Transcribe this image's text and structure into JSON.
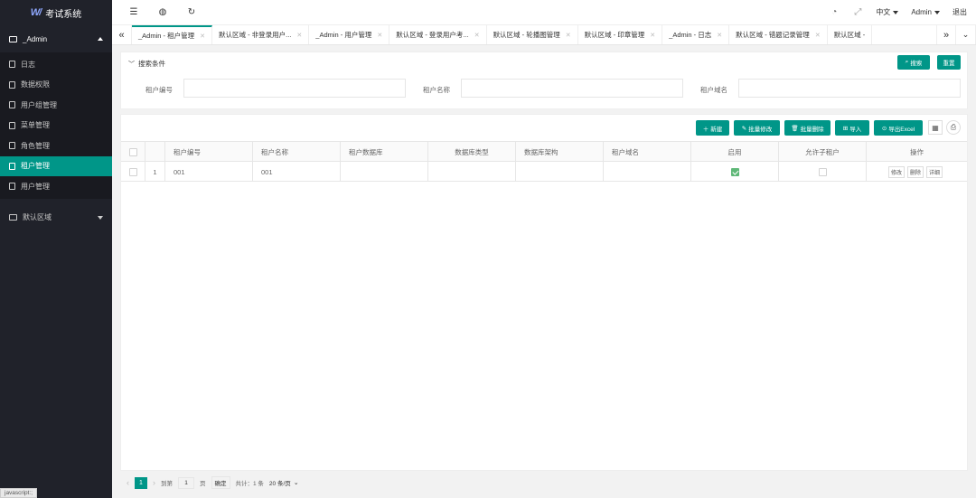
{
  "app": {
    "title": "考试系统",
    "logo_mark": "W/"
  },
  "sidebar": {
    "group1": {
      "label": "_Admin"
    },
    "items": [
      {
        "label": "日志"
      },
      {
        "label": "数据权限"
      },
      {
        "label": "用户组管理"
      },
      {
        "label": "菜单管理"
      },
      {
        "label": "角色管理"
      },
      {
        "label": "租户管理"
      },
      {
        "label": "用户管理"
      }
    ],
    "group2": {
      "label": "默认区域"
    },
    "status_tip": "javascript:;"
  },
  "header": {
    "lang": "中文",
    "user": "Admin",
    "logout": "退出"
  },
  "tabs": [
    {
      "label": "_Admin - 租户管理"
    },
    {
      "label": "默认区域 - 非登录用户..."
    },
    {
      "label": "_Admin - 用户管理"
    },
    {
      "label": "默认区域 - 登录用户考..."
    },
    {
      "label": "默认区域 - 轮播图管理"
    },
    {
      "label": "默认区域 - 印章管理"
    },
    {
      "label": "_Admin - 日志"
    },
    {
      "label": "默认区域 - 错题记录管理"
    },
    {
      "label": "默认区域 -"
    }
  ],
  "search": {
    "title": "搜索条件",
    "search_btn": "搜索",
    "reset_btn": "重置",
    "fields": [
      {
        "label": "租户编号"
      },
      {
        "label": "租户名称"
      },
      {
        "label": "租户域名"
      }
    ]
  },
  "toolbar": {
    "new": "新建",
    "batch_edit": "批量修改",
    "batch_delete": "批量删除",
    "import": "导入",
    "export": "导出Excel"
  },
  "table": {
    "columns": [
      "租户编号",
      "租户名称",
      "租户数据库",
      "数据库类型",
      "数据库架构",
      "租户域名",
      "启用",
      "允许子租户",
      "操作"
    ],
    "rows": [
      {
        "index": "1",
        "code": "001",
        "name": "001",
        "db": "",
        "db_type": "",
        "db_schema": "",
        "domain": "",
        "enabled": true,
        "allow_child": false
      }
    ],
    "row_actions": {
      "edit": "修改",
      "delete": "删除",
      "detail": "详细"
    }
  },
  "pager": {
    "current": "1",
    "goto_label": "到第",
    "goto_value": "1",
    "page_unit": "页",
    "confirm": "确定",
    "total": "共计：1 条",
    "page_size": "20 条/页"
  }
}
